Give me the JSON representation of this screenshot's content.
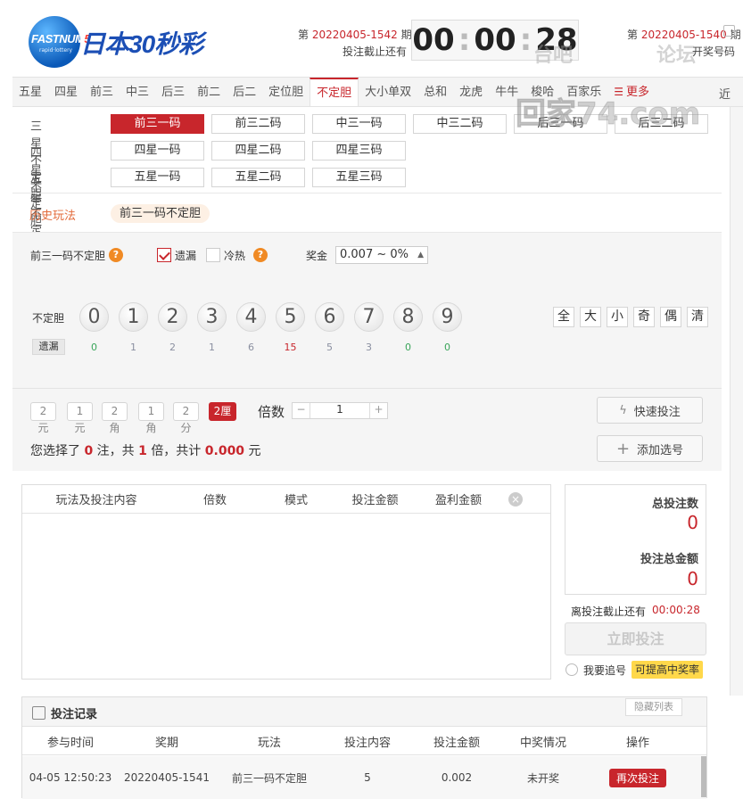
{
  "header": {
    "logo_text_a": "FASTNUM",
    "logo_text_b": "5",
    "logo_sub": "rapid·lottery",
    "game_title": "日本30秒彩",
    "current_prefix": "第",
    "current_issue": "20220405-1542",
    "current_suffix": "期",
    "deadline_label": "投注截止还有",
    "clock": {
      "h": "00",
      "m": "00",
      "s": "28"
    },
    "last_prefix": "第",
    "last_issue": "20220405-1540",
    "last_suffix": "期",
    "draw_label": "开奖号码"
  },
  "tabs": [
    "五星",
    "四星",
    "前三",
    "中三",
    "后三",
    "前二",
    "后二",
    "定位胆",
    "不定胆",
    "大小单双",
    "总和",
    "龙虎",
    "牛牛",
    "梭哈",
    "百家乐"
  ],
  "tabs_more": "更多",
  "tabs_extra": "近",
  "subplays": {
    "rows": [
      {
        "label": "三星不定胆",
        "options": [
          "前三一码",
          "前三二码",
          "中三一码",
          "中三二码",
          "后三一码",
          "后三二码"
        ]
      },
      {
        "label": "四星不定胆",
        "options": [
          "四星一码",
          "四星二码",
          "四星三码"
        ]
      },
      {
        "label": "五星不定胆",
        "options": [
          "五星一码",
          "五星二码",
          "五星三码"
        ]
      }
    ]
  },
  "history": {
    "label": "历史玩法",
    "chip": "前三一码不定胆"
  },
  "panel": {
    "play_name": "前三一码不定胆",
    "q": "?",
    "miss_label": "遗漏",
    "hot_label": "冷热",
    "prize_label": "奖金",
    "prize_value": "0.007 ~ 0%",
    "row_label": "不定胆",
    "miss_row_label": "遗漏",
    "balls": [
      "0",
      "1",
      "2",
      "3",
      "4",
      "5",
      "6",
      "7",
      "8",
      "9"
    ],
    "misses": [
      "0",
      "1",
      "2",
      "1",
      "6",
      "15",
      "5",
      "3",
      "0",
      "0"
    ],
    "miss_colors": [
      "#3aa55a",
      "#8a8fa0",
      "#8a8fa0",
      "#8a8fa0",
      "#8a8fa0",
      "#c8262c",
      "#8a8fa0",
      "#8a8fa0",
      "#3aa55a",
      "#3aa55a"
    ],
    "quick": [
      "全",
      "大",
      "小",
      "奇",
      "偶",
      "清"
    ],
    "units": [
      "2元",
      "1元",
      "2角",
      "1角",
      "2分",
      "2厘"
    ],
    "multiple_label": "倍数",
    "multiple_value": "1",
    "minus": "−",
    "plus": "+",
    "quick_bet": "快速投注",
    "add_selection": "添加选号",
    "summary": {
      "a": "您选择了",
      "count": "0",
      "b": "注，共",
      "times": "1",
      "c": "倍，共计",
      "amount": "0.000",
      "d": "元"
    }
  },
  "slip": {
    "headers": [
      "玩法及投注内容",
      "倍数",
      "模式",
      "投注金额",
      "盈利金额"
    ]
  },
  "totals": {
    "count_label": "总投注数",
    "count": "0",
    "amount_label": "投注总金额",
    "amount": "0",
    "deadline_label": "离投注截止还有",
    "deadline": "00:00:28",
    "submit": "立即投注",
    "chase_label": "我要追号",
    "chase_tip": "可提高中奖率"
  },
  "record": {
    "title": "投注记录",
    "hide": "隐藏列表",
    "headers": [
      "参与时间",
      "奖期",
      "玩法",
      "投注内容",
      "投注金额",
      "中奖情况",
      "操作"
    ],
    "rows": [
      {
        "time": "04-05 12:50:23",
        "issue": "20220405-1541",
        "play": "前三一码不定胆",
        "content": "5",
        "amount": "0.002",
        "status": "未开奖",
        "action": "再次投注"
      }
    ]
  },
  "watermark": {
    "a": "台吧",
    "b": "论坛",
    "c": "回家74.com"
  }
}
